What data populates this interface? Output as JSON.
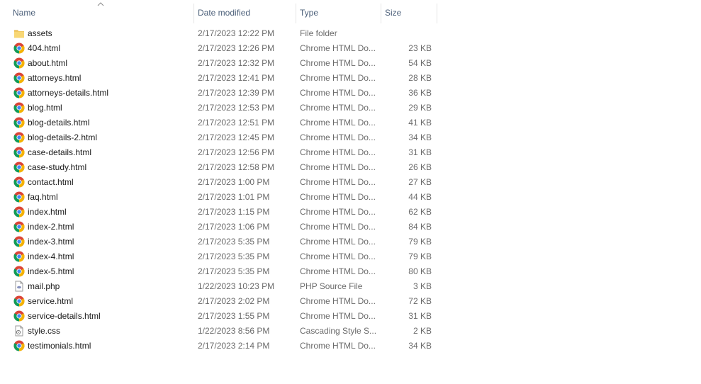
{
  "columns": {
    "name": "Name",
    "date": "Date modified",
    "type": "Type",
    "size": "Size"
  },
  "files": [
    {
      "name": "assets",
      "date": "2/17/2023 12:22 PM",
      "type": "File folder",
      "size": "",
      "icon": "folder-icon"
    },
    {
      "name": "404.html",
      "date": "2/17/2023 12:26 PM",
      "type": "Chrome HTML Do...",
      "size": "23 KB",
      "icon": "chrome-icon"
    },
    {
      "name": "about.html",
      "date": "2/17/2023 12:32 PM",
      "type": "Chrome HTML Do...",
      "size": "54 KB",
      "icon": "chrome-icon"
    },
    {
      "name": "attorneys.html",
      "date": "2/17/2023 12:41 PM",
      "type": "Chrome HTML Do...",
      "size": "28 KB",
      "icon": "chrome-icon"
    },
    {
      "name": "attorneys-details.html",
      "date": "2/17/2023 12:39 PM",
      "type": "Chrome HTML Do...",
      "size": "36 KB",
      "icon": "chrome-icon"
    },
    {
      "name": "blog.html",
      "date": "2/17/2023 12:53 PM",
      "type": "Chrome HTML Do...",
      "size": "29 KB",
      "icon": "chrome-icon"
    },
    {
      "name": "blog-details.html",
      "date": "2/17/2023 12:51 PM",
      "type": "Chrome HTML Do...",
      "size": "41 KB",
      "icon": "chrome-icon"
    },
    {
      "name": "blog-details-2.html",
      "date": "2/17/2023 12:45 PM",
      "type": "Chrome HTML Do...",
      "size": "34 KB",
      "icon": "chrome-icon"
    },
    {
      "name": "case-details.html",
      "date": "2/17/2023 12:56 PM",
      "type": "Chrome HTML Do...",
      "size": "31 KB",
      "icon": "chrome-icon"
    },
    {
      "name": "case-study.html",
      "date": "2/17/2023 12:58 PM",
      "type": "Chrome HTML Do...",
      "size": "26 KB",
      "icon": "chrome-icon"
    },
    {
      "name": "contact.html",
      "date": "2/17/2023 1:00 PM",
      "type": "Chrome HTML Do...",
      "size": "27 KB",
      "icon": "chrome-icon"
    },
    {
      "name": "faq.html",
      "date": "2/17/2023 1:01 PM",
      "type": "Chrome HTML Do...",
      "size": "44 KB",
      "icon": "chrome-icon"
    },
    {
      "name": "index.html",
      "date": "2/17/2023 1:15 PM",
      "type": "Chrome HTML Do...",
      "size": "62 KB",
      "icon": "chrome-icon"
    },
    {
      "name": "index-2.html",
      "date": "2/17/2023 1:06 PM",
      "type": "Chrome HTML Do...",
      "size": "84 KB",
      "icon": "chrome-icon"
    },
    {
      "name": "index-3.html",
      "date": "2/17/2023 5:35 PM",
      "type": "Chrome HTML Do...",
      "size": "79 KB",
      "icon": "chrome-icon"
    },
    {
      "name": "index-4.html",
      "date": "2/17/2023 5:35 PM",
      "type": "Chrome HTML Do...",
      "size": "79 KB",
      "icon": "chrome-icon"
    },
    {
      "name": "index-5.html",
      "date": "2/17/2023 5:35 PM",
      "type": "Chrome HTML Do...",
      "size": "80 KB",
      "icon": "chrome-icon"
    },
    {
      "name": "mail.php",
      "date": "1/22/2023 10:23 PM",
      "type": "PHP Source File",
      "size": "3 KB",
      "icon": "php-file-icon"
    },
    {
      "name": "service.html",
      "date": "2/17/2023 2:02 PM",
      "type": "Chrome HTML Do...",
      "size": "72 KB",
      "icon": "chrome-icon"
    },
    {
      "name": "service-details.html",
      "date": "2/17/2023 1:55 PM",
      "type": "Chrome HTML Do...",
      "size": "31 KB",
      "icon": "chrome-icon"
    },
    {
      "name": "style.css",
      "date": "1/22/2023 8:56 PM",
      "type": "Cascading Style S...",
      "size": "2 KB",
      "icon": "css-file-icon"
    },
    {
      "name": "testimonials.html",
      "date": "2/17/2023 2:14 PM",
      "type": "Chrome HTML Do...",
      "size": "34 KB",
      "icon": "chrome-icon"
    }
  ],
  "colors": {
    "header_text": "#4c607a",
    "secondary_text": "#6b6b6b",
    "folder": "#f8d775"
  }
}
